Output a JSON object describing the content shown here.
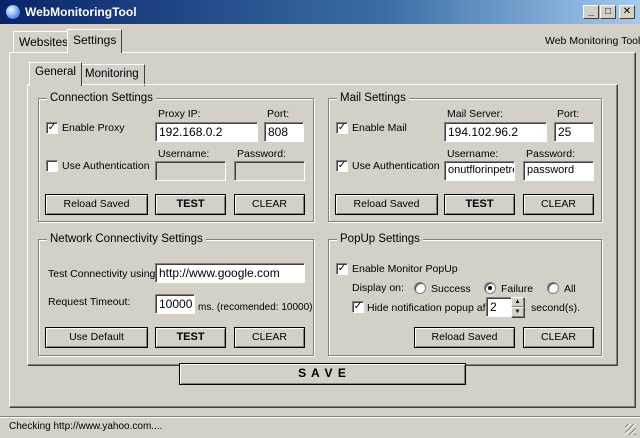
{
  "window": {
    "title": "WebMonitoringTool",
    "minimize_glyph": "_",
    "maximize_glyph": "□",
    "close_glyph": "✕",
    "header_right": "Web Monitoring Tool"
  },
  "tabs": {
    "top": [
      "Websites",
      "Settings"
    ],
    "sub": [
      "General",
      "Monitoring"
    ]
  },
  "connection": {
    "title": "Connection Settings",
    "enable_proxy": "Enable Proxy",
    "proxy_ip_label": "Proxy IP:",
    "proxy_ip": "192.168.0.2",
    "port_label": "Port:",
    "port": "808",
    "use_auth": "Use Authentication",
    "username_label": "Username:",
    "password_label": "Password:",
    "username": "",
    "password": "",
    "reload": "Reload Saved",
    "test": "TEST",
    "clear": "CLEAR"
  },
  "mail": {
    "title": "Mail Settings",
    "enable_mail": "Enable Mail",
    "server_label": "Mail Server:",
    "server": "194.102.96.2",
    "port_label": "Port:",
    "port": "25",
    "use_auth": "Use Authentication",
    "username_label": "Username:",
    "password_label": "Password:",
    "username": "onutflorinpetre",
    "password": "password",
    "reload": "Reload Saved",
    "test": "TEST",
    "clear": "CLEAR"
  },
  "network": {
    "title": "Network Connectivity Settings",
    "test_label": "Test Connectivity using:",
    "test_url": "http://www.google.com",
    "timeout_label": "Request Timeout:",
    "timeout": "10000",
    "timeout_hint": "ms. (recomended: 10000)",
    "use_default": "Use Default",
    "test": "TEST",
    "clear": "CLEAR"
  },
  "popup": {
    "title": "PopUp Settings",
    "enable_popup": "Enable Monitor PopUp",
    "display_on": "Display on:",
    "success": "Success",
    "failure": "Failure",
    "all": "All",
    "hide_after": "Hide notification popup after:",
    "hide_seconds": "2",
    "seconds_label": "second(s).",
    "reload": "Reload Saved",
    "clear": "CLEAR"
  },
  "save": "S A V E",
  "status": "Checking http://www.yahoo.com...."
}
